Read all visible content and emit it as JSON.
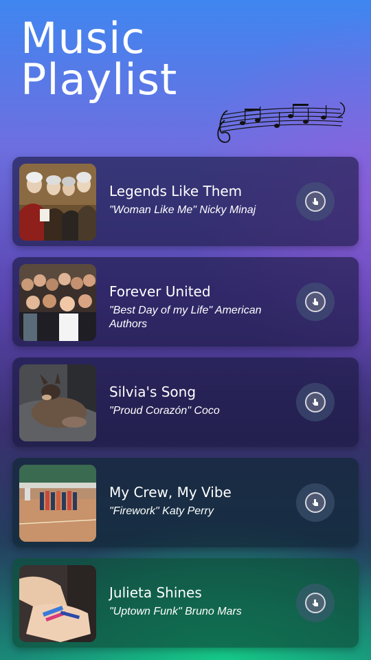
{
  "header": {
    "title_line1": "Music",
    "title_line2": "Playlist"
  },
  "decoration": {
    "icon": "music-notes-icon"
  },
  "playlist": [
    {
      "title": "Legends Like Them",
      "subtitle": "\"Woman Like Me\" Nicky Minaj",
      "image": "portrait-painting",
      "button_icon": "tap-icon"
    },
    {
      "title": "Forever United",
      "subtitle": "\"Best Day of my Life\" American Authors",
      "image": "group-selfie",
      "button_icon": "tap-icon"
    },
    {
      "title": "Silvia's Song",
      "subtitle": "\"Proud Corazón\" Coco",
      "image": "sleeping-dog",
      "button_icon": "tap-icon"
    },
    {
      "title": "My Crew, My Vibe",
      "subtitle": "\"Firework\" Katy Perry",
      "image": "team-huddle",
      "button_icon": "tap-icon"
    },
    {
      "title": "Julieta Shines",
      "subtitle": "\"Uptown Funk\" Bruno Mars",
      "image": "friendship-bracelets",
      "button_icon": "tap-icon"
    }
  ]
}
